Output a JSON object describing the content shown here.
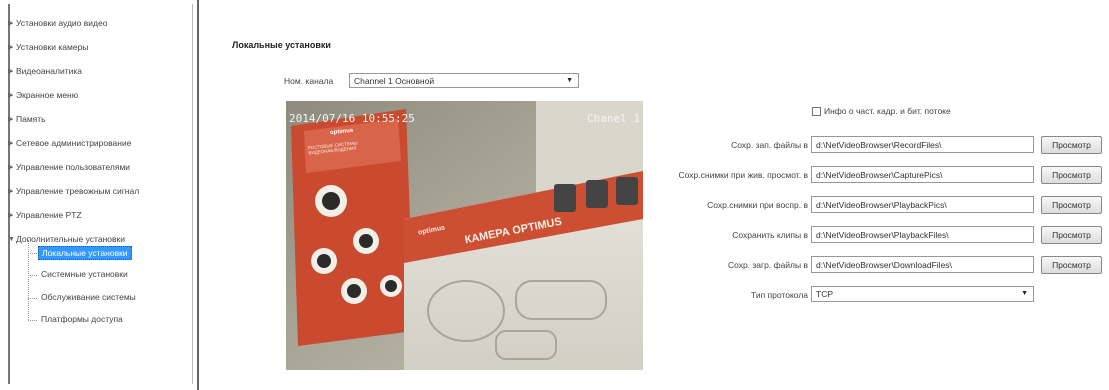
{
  "sidebar": {
    "items": [
      {
        "label": "Установки аудио видео"
      },
      {
        "label": "Установки камеры"
      },
      {
        "label": "Видеоаналитика"
      },
      {
        "label": "Экранное меню"
      },
      {
        "label": "Память"
      },
      {
        "label": "Сетевое администрирование"
      },
      {
        "label": "Управление пользователями"
      },
      {
        "label": "Управление тревожным сигнал"
      },
      {
        "label": "Управление PTZ"
      },
      {
        "label": "Дополнительные установки"
      }
    ],
    "subitems": [
      {
        "label": "Локальные установки"
      },
      {
        "label": "Системные установки"
      },
      {
        "label": "Обслуживание системы"
      },
      {
        "label": "Платформы доступа"
      }
    ]
  },
  "main": {
    "title": "Локальные установки",
    "channel_label": "Ном. канала",
    "channel_value": "Channel 1 Основной",
    "preview": {
      "timestamp": "2014/07/16 10:55:25",
      "channel_osd": "Chanel 1",
      "box_text": "КАМЕРА OPTIMUS",
      "brand_text": "optimus",
      "poster_text": "РОСТОВЫЕ СИСТЕМЫ ВИДЕОНАБЛЮДЕНИЯ"
    },
    "info_checkbox_label": "Инфо о част. кадр. и бит. потоке",
    "fields": [
      {
        "label": "Сохр. зап. файлы в",
        "value": "d:\\NetVideoBrowser\\RecordFiles\\",
        "button": "Просмотр"
      },
      {
        "label": "Сохр.снимки при жив. просмот. в",
        "value": "d:\\NetVideoBrowser\\CapturePics\\",
        "button": "Просмотр"
      },
      {
        "label": "Сохр.снимки при воспр. в",
        "value": "d:\\NetVideoBrowser\\PlaybackPics\\",
        "button": "Просмотр"
      },
      {
        "label": "Сохранить клипы в",
        "value": "d:\\NetVideoBrowser\\PlaybackFiles\\",
        "button": "Просмотр"
      },
      {
        "label": "Сохр. загр. файлы в",
        "value": "d:\\NetVideoBrowser\\DownloadFiles\\",
        "button": "Просмотр"
      }
    ],
    "protocol_label": "Тип протокола",
    "protocol_value": "TCP"
  }
}
